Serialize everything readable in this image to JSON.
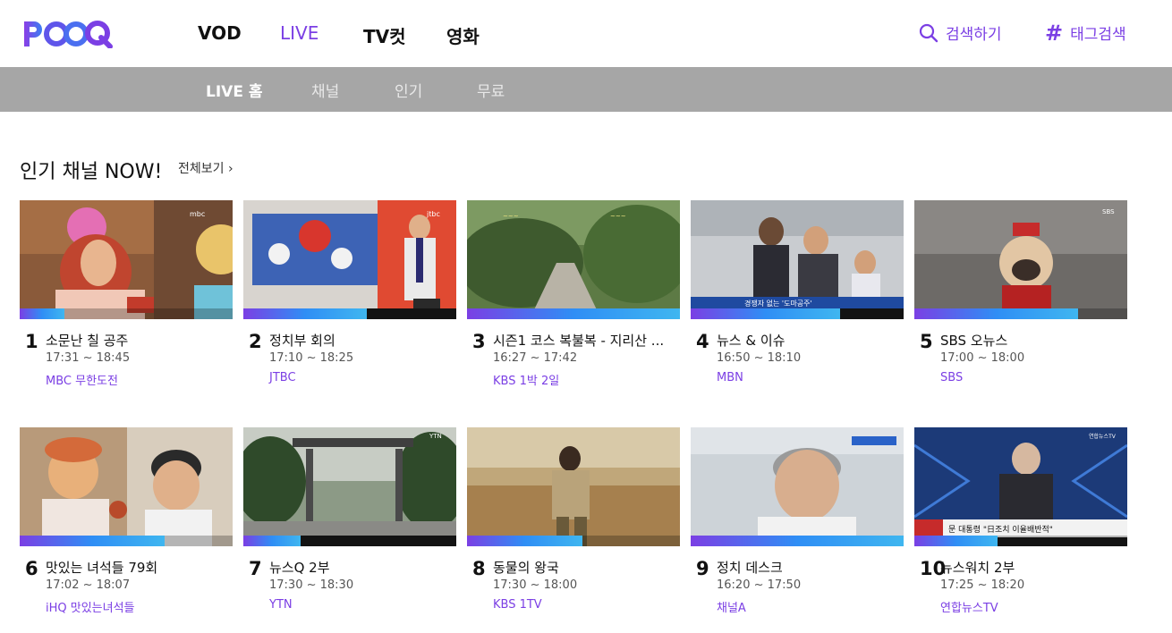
{
  "brand": {
    "logo": "POOQ",
    "accent": "#7b3fe4"
  },
  "nav": {
    "main": [
      "VOD",
      "LIVE",
      "TV컷",
      "영화"
    ],
    "active": "LIVE",
    "search_label": "검색하기",
    "tag_label": "태그검색"
  },
  "subnav": {
    "items": [
      "LIVE 홈",
      "채널",
      "인기",
      "무료"
    ],
    "active": "LIVE 홈"
  },
  "section": {
    "title": "인기 채널 NOW!",
    "see_all": "전체보기"
  },
  "channels": [
    {
      "rank": "1",
      "title": "소문난 칠 공주",
      "time": "17:31 ~ 18:45",
      "channel": "MBC 무한도전",
      "progress": 0.21
    },
    {
      "rank": "2",
      "title": "정치부 회의",
      "time": "17:10 ~ 18:25",
      "channel": "JTBC",
      "progress": 0.58
    },
    {
      "rank": "3",
      "title": "시즌1 코스 복불복 - 지리산 ...",
      "time": "16:27 ~ 17:42",
      "channel": "KBS 1박 2일",
      "progress": 1.0
    },
    {
      "rank": "4",
      "title": "뉴스 & 이슈",
      "time": "16:50 ~ 18:10",
      "channel": "MBN",
      "progress": 0.7
    },
    {
      "rank": "5",
      "title": "SBS 오뉴스",
      "time": "17:00 ~ 18:00",
      "channel": "SBS",
      "progress": 0.77
    },
    {
      "rank": "6",
      "title": "맛있는 녀석들 79회",
      "time": "17:02 ~ 18:07",
      "channel": "iHQ 맛있는녀석들",
      "progress": 0.68
    },
    {
      "rank": "7",
      "title": "뉴스Q 2부",
      "time": "17:30 ~ 18:30",
      "channel": "YTN",
      "progress": 0.27
    },
    {
      "rank": "8",
      "title": "동물의 왕국",
      "time": "17:30 ~ 18:00",
      "channel": "KBS 1TV",
      "progress": 0.54
    },
    {
      "rank": "9",
      "title": "정치 데스크",
      "time": "16:20 ~ 17:50",
      "channel": "채널A",
      "progress": 1.0
    },
    {
      "rank": "10",
      "title": "뉴스워치 2부",
      "time": "17:25 ~ 18:20",
      "channel": "연합뉴스TV",
      "progress": 0.39
    }
  ]
}
